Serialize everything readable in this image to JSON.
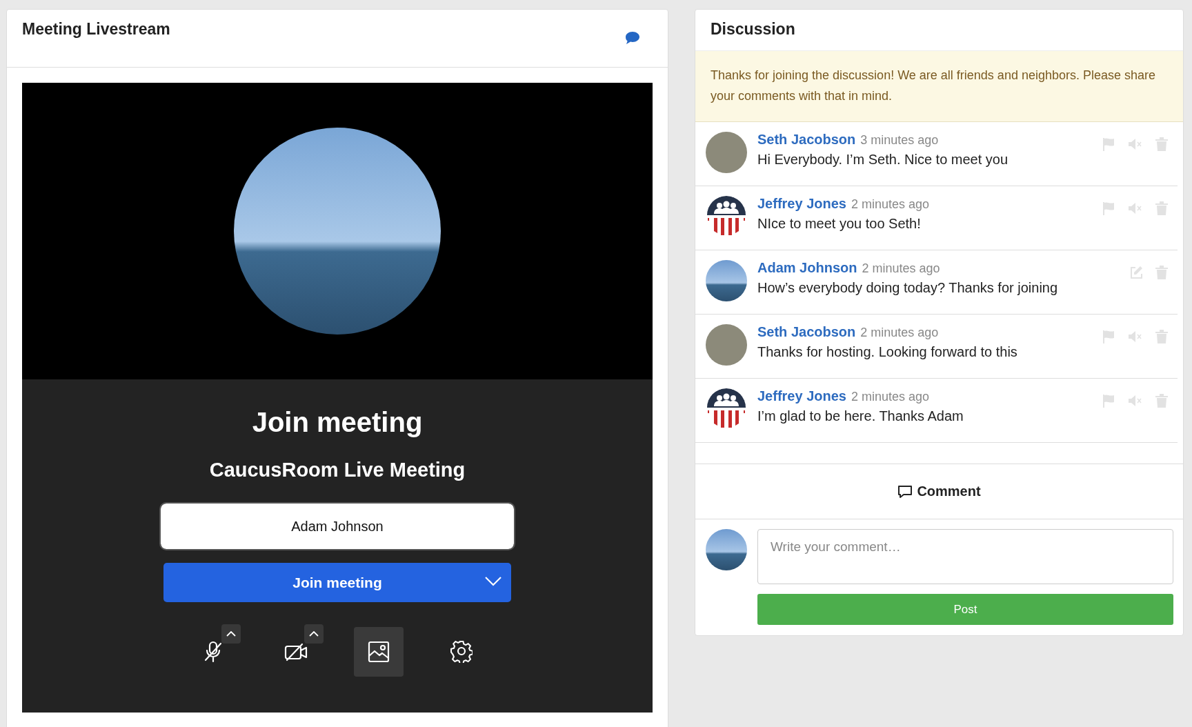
{
  "livestream": {
    "title": "Meeting Livestream",
    "heading": "Join meeting",
    "subtitle": "CaucusRoom Live Meeting",
    "name_field": {
      "value": "Adam Johnson"
    },
    "join_button": "Join meeting",
    "controls": [
      {
        "kind": "mic",
        "selected": false,
        "menu": true
      },
      {
        "kind": "camera",
        "selected": false,
        "menu": true
      },
      {
        "kind": "background",
        "selected": true,
        "menu": false
      },
      {
        "kind": "settings",
        "selected": false,
        "menu": false
      }
    ]
  },
  "discussion": {
    "title": "Discussion",
    "notice": "Thanks for joining the discussion! We are all friends and neighbors. Please share your comments with that in mind.",
    "comments": [
      {
        "author": "Seth Jacobson",
        "time": "3 minutes ago",
        "text": "Hi Everybody. I’m Seth. Nice to meet you",
        "kind": "photo",
        "own": false
      },
      {
        "author": "Jeffrey Jones",
        "time": "2 minutes ago",
        "text": "NIce to meet you too Seth!",
        "kind": "logo",
        "own": false
      },
      {
        "author": "Adam Johnson",
        "time": "2 minutes ago",
        "text": "How’s everybody doing today? Thanks for joining",
        "kind": "landscape",
        "own": true
      },
      {
        "author": "Seth Jacobson",
        "time": "2 minutes ago",
        "text": "Thanks for hosting. Looking forward to this",
        "kind": "photo",
        "own": false
      },
      {
        "author": "Jeffrey Jones",
        "time": "2 minutes ago",
        "text": "I’m glad to be here. Thanks Adam",
        "kind": "logo",
        "own": false
      }
    ],
    "comment_button": "Comment",
    "composer": {
      "placeholder": "Write your comment…",
      "post_button": "Post"
    }
  }
}
